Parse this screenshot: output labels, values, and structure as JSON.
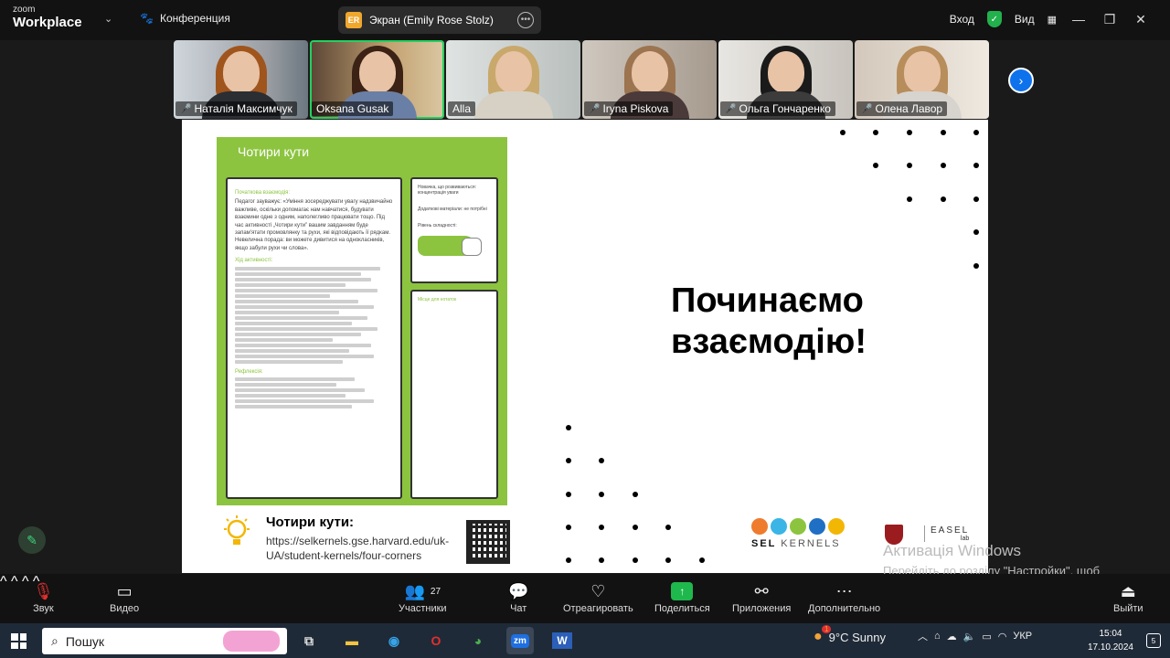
{
  "topbar": {
    "brand_small": "zoom",
    "brand_big": "Workplace",
    "conference_label": "Конференция",
    "share_badge": "ER",
    "share_text": "Экран (Emily Rose Stolz)",
    "login_label": "Вход",
    "view_label": "Вид"
  },
  "participants": [
    {
      "name": "Наталія Максимчук",
      "muted": true
    },
    {
      "name": "Oksana Gusak",
      "muted": false
    },
    {
      "name": "Alla",
      "muted": false
    },
    {
      "name": "Iryna Piskova",
      "muted": true
    },
    {
      "name": "Ольга Гончаренко",
      "muted": true
    },
    {
      "name": "Олена Лавор",
      "muted": true
    }
  ],
  "slide": {
    "card_title": "Чотири кути",
    "card_intro_heading": "Початкова взаємодія:",
    "card_intro_text": "Педагог зауважує: «Уміння зосереджувати увагу надзвичайно важливе, оскільки допомагає нам навчатися, будувати взаємини одне з одним, наполегливо працювати тощо. Під час активності „Чотири кути” вашим завданням буде запам'ятати промовлянку та рухи, які відповідають її рядкам. Невелична порада: ви можете дивитися на однокласників, якщо забули рухи чи слова».",
    "card_process_heading": "Хід активності:",
    "card_reflection_heading": "Рефлексія:",
    "card_side_1": "Новачкa, що розвиваються: концентрація уваги",
    "card_side_2": "Додаткові матеріали: не потрібні",
    "card_side_3": "Рівень складності:",
    "card_notes": "Місце для нотаток",
    "footer_title": "Чотири кути:",
    "footer_url": "https://selkernels.gse.harvard.edu/uk-UA/student-kernels/four-corners",
    "heading_line1": "Починаємо",
    "heading_line2": "взаємодію!",
    "sel_logo_text_1": "SEL",
    "sel_logo_text_2": "KERNELS",
    "easel_text": "EASEL",
    "easel_sub": "lab",
    "accent_green": "#8cc440"
  },
  "watermark": {
    "title": "Активація Windows",
    "text": "Перейдіть до розділу \"Настройки\", щоб активувати Windows."
  },
  "toolbar": {
    "sound": "Звук",
    "video": "Видео",
    "participants": "Участники",
    "participants_count": "27",
    "chat": "Чат",
    "react": "Отреагировать",
    "share": "Поделиться",
    "apps": "Приложения",
    "more": "Дополнительно",
    "exit": "Выйти"
  },
  "taskbar": {
    "search_label": "Пошук",
    "weather": "9°C  Sunny",
    "weather_badge": "1",
    "lang": "УКР",
    "time": "15:04",
    "date": "17.10.2024",
    "notif_count": "5"
  }
}
